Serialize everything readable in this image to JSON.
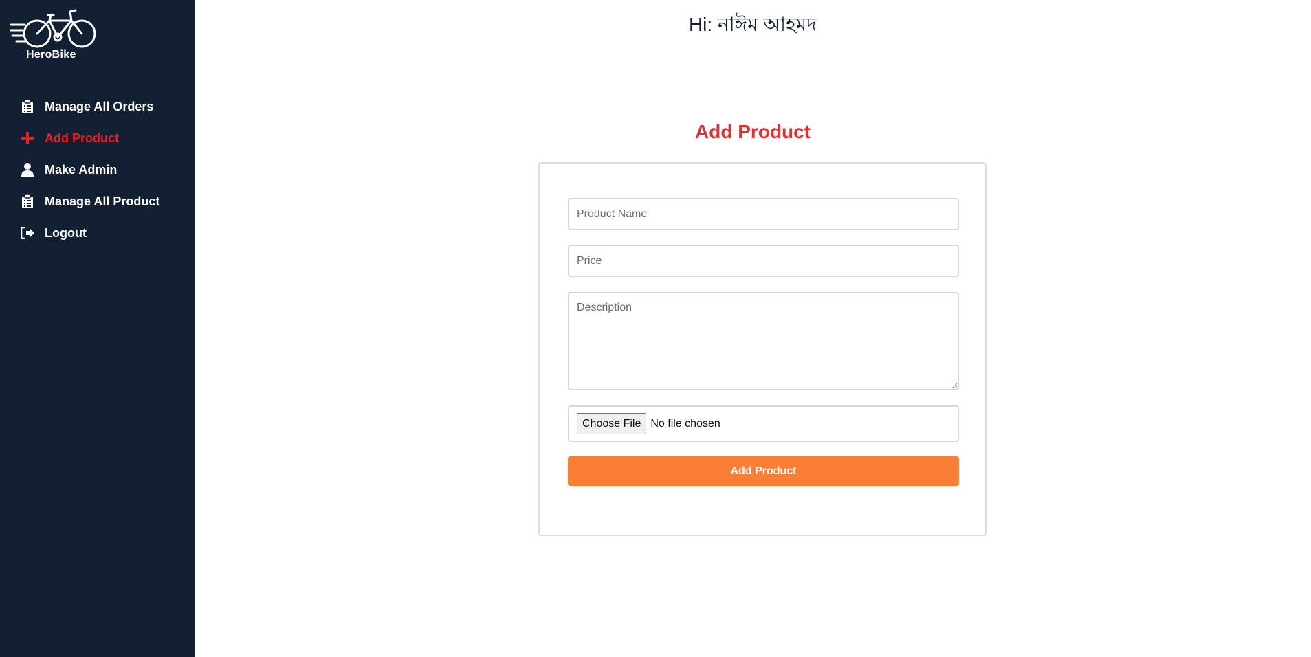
{
  "brand": {
    "name": "HeroBike",
    "logo_icon": "bicycle-icon"
  },
  "sidebar": {
    "items": [
      {
        "label": "Manage All Orders",
        "icon": "clipboard-list-icon",
        "active": false
      },
      {
        "label": "Add Product",
        "icon": "plus-icon",
        "active": true
      },
      {
        "label": "Make Admin",
        "icon": "user-icon",
        "active": false
      },
      {
        "label": "Manage All Product",
        "icon": "clipboard-list-icon",
        "active": false
      },
      {
        "label": "Logout",
        "icon": "sign-out-icon",
        "active": false
      }
    ]
  },
  "header": {
    "greeting": "Hi: নাঈম আহমদ"
  },
  "form": {
    "title": "Add Product",
    "name_placeholder": "Product Name",
    "price_placeholder": "Price",
    "description_placeholder": "Description",
    "file_button": "Choose File",
    "file_status": "No file chosen",
    "submit_label": "Add Product"
  },
  "colors": {
    "sidebar_bg": "#131f33",
    "active_nav": "#ee1c1c",
    "title": "#e03131",
    "submit_bg": "#f97e36"
  }
}
